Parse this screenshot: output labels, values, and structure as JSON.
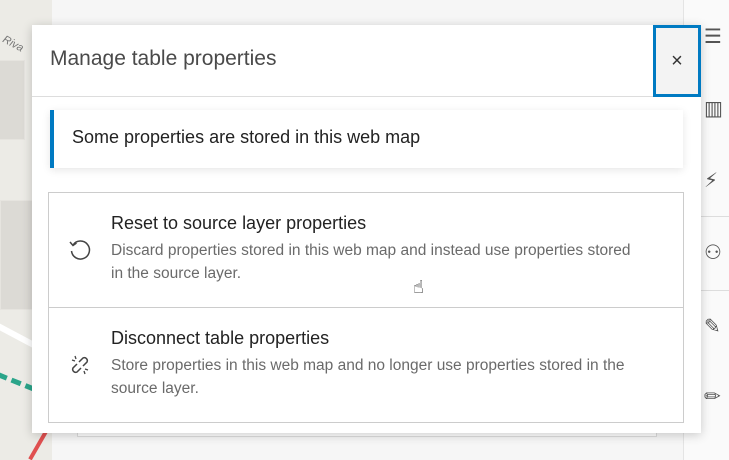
{
  "map": {
    "street_label": "Riva"
  },
  "dialog": {
    "title": "Manage table properties",
    "close_label": "×",
    "notice": "Some properties are stored in this web map",
    "options": [
      {
        "title": "Reset to source layer properties",
        "description": "Discard properties stored in this web map and instead use properties stored in the source layer.",
        "icon": "reset-icon"
      },
      {
        "title": "Disconnect table properties",
        "description": "Store properties in this web map and no longer use properties stored in the source layer.",
        "icon": "unlink-icon"
      }
    ]
  },
  "accent_color": "#007ac2"
}
